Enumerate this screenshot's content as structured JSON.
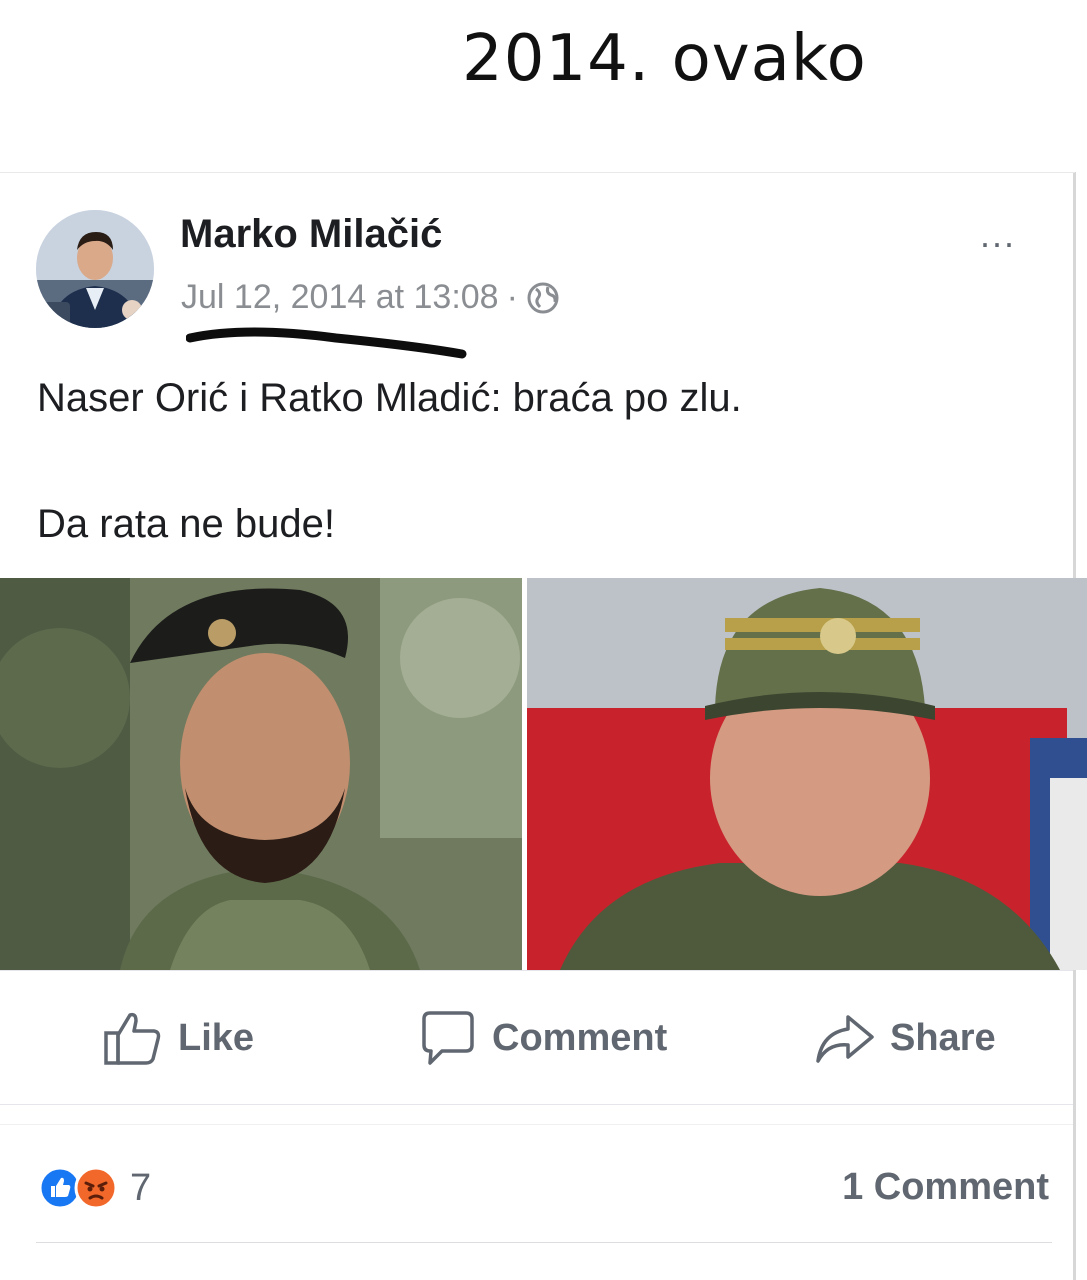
{
  "caption": "2014. ovako",
  "post": {
    "author": "Marko Milačić",
    "timestamp": "Jul 12, 2014 at 13:08",
    "separator": "·",
    "privacy_icon": "globe-icon",
    "more_label": "...",
    "lines": [
      "Naser Orić i Ratko Mladić: braća po zlu.",
      "Da rata ne bude!"
    ]
  },
  "actions": {
    "like_label": "Like",
    "comment_label": "Comment",
    "share_label": "Share"
  },
  "footer": {
    "reactions": [
      "like-icon",
      "angry-icon"
    ],
    "reaction_count": "7",
    "comments_count": "1 Comment"
  },
  "colors": {
    "like_blue": "#1877f2",
    "angry_orange": "#f2682a",
    "text_secondary": "#606770"
  }
}
